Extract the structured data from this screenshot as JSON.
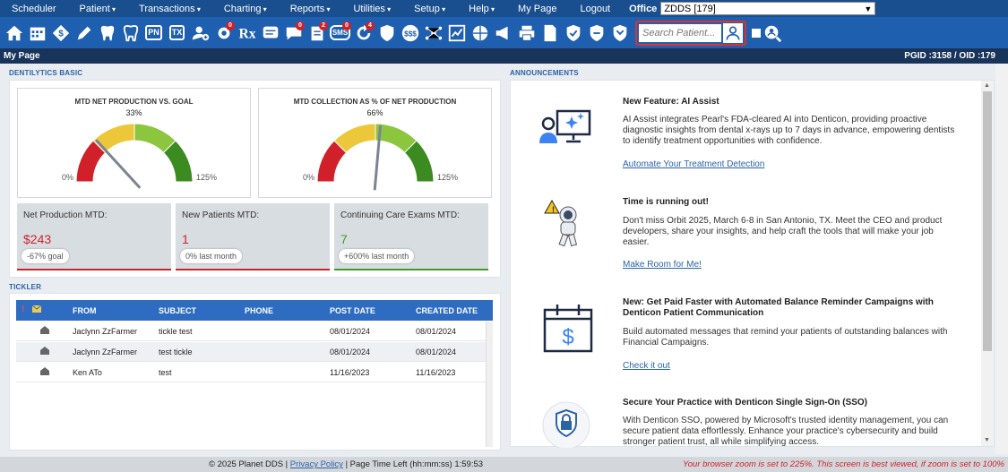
{
  "menu": {
    "items": [
      {
        "label": "Scheduler",
        "dd": false
      },
      {
        "label": "Patient",
        "dd": true
      },
      {
        "label": "Transactions",
        "dd": true
      },
      {
        "label": "Charting",
        "dd": true
      },
      {
        "label": "Reports",
        "dd": true
      },
      {
        "label": "Utilities",
        "dd": true
      },
      {
        "label": "Setup",
        "dd": true
      },
      {
        "label": "Help",
        "dd": true
      },
      {
        "label": "My Page",
        "dd": false
      },
      {
        "label": "Logout",
        "dd": false
      }
    ],
    "office_label": "Office",
    "office_value": "ZDDS [179]"
  },
  "toolbar": {
    "pn": "PN",
    "tx": "TX",
    "sms": "SMS",
    "dollar": "$$$",
    "badges": {
      "charting": "0",
      "messages": "0",
      "tasks": "2",
      "sms": "0",
      "recall": "4"
    },
    "search_placeholder": "Search Patient..."
  },
  "page": {
    "title": "My Page",
    "ids": "PGID :3158  /  OID :179"
  },
  "dentilytics": {
    "section_title": "DENTILYTICS BASIC",
    "gauges": [
      {
        "title": "MTD NET PRODUCTION VS. GOAL",
        "pct": "33%",
        "min": "0%",
        "max": "125%",
        "value": 33
      },
      {
        "title": "MTD COLLECTION AS % OF NET PRODUCTION",
        "pct": "66%",
        "min": "0%",
        "max": "125%",
        "value": 66
      }
    ],
    "stats": [
      {
        "label": "Net Production MTD:",
        "value": "$243",
        "chip": "-67% goal",
        "color": "#d0212a"
      },
      {
        "label": "New Patients MTD:",
        "value": "1",
        "chip": "0% last month",
        "color": "#d0212a"
      },
      {
        "label": "Continuing Care Exams MTD:",
        "value": "7",
        "chip": "+600% last month",
        "color": "#3f9b2a"
      }
    ]
  },
  "tickler": {
    "section_title": "TICKLER",
    "headers": {
      "flag": "!",
      "from": "FROM",
      "subject": "SUBJECT",
      "phone": "PHONE",
      "post_date": "POST DATE",
      "created_date": "CREATED DATE"
    },
    "rows": [
      {
        "from": "Jaclynn ZzFarmer",
        "subject": "tickle test",
        "phone": "",
        "post_date": "08/01/2024",
        "created_date": "08/01/2024"
      },
      {
        "from": "Jaclynn ZzFarmer",
        "subject": "test tickle",
        "phone": "",
        "post_date": "08/01/2024",
        "created_date": "08/01/2024"
      },
      {
        "from": "Ken ATo",
        "subject": "test",
        "phone": "",
        "post_date": "11/16/2023",
        "created_date": "11/16/2023"
      }
    ]
  },
  "announcements": {
    "section_title": "ANNOUNCEMENTS",
    "items": [
      {
        "title": "New Feature: AI Assist",
        "body": "AI Assist integrates Pearl's FDA-cleared AI into Denticon, providing proactive diagnostic insights from dental x-rays up to 7 days in advance, empowering dentists to identify treatment opportunities with confidence.",
        "link": "Automate Your Treatment Detection"
      },
      {
        "title": "Time is running out!",
        "body": "Don't miss Orbit 2025, March 6-8 in San Antonio, TX. Meet the CEO and product developers, share your insights, and help craft the tools that will make your job easier.",
        "link": "Make Room for Me!"
      },
      {
        "title": "New: Get Paid Faster with Automated Balance Reminder Campaigns with Denticon Patient Communication",
        "body": "Build automated messages that remind your patients of outstanding balances with Financial Campaigns.",
        "link": "Check it out"
      },
      {
        "title": "Secure Your Practice with Denticon Single Sign-On (SSO)",
        "body": "With Denticon SSO, powered by Microsoft's trusted identity management, you can secure patient data effortlessly. Enhance your practice's cybersecurity and build stronger patient trust, all while simplifying access.",
        "link": ""
      }
    ]
  },
  "footer": {
    "copyright": "© 2025 Planet DDS |",
    "privacy": "Privacy Policy",
    "time_left": "| Page Time Left (hh:mm:ss) 1:59:53",
    "zoom_warning": "Your browser zoom is set to 225%. This screen is best viewed, if zoom is set to 100%"
  }
}
